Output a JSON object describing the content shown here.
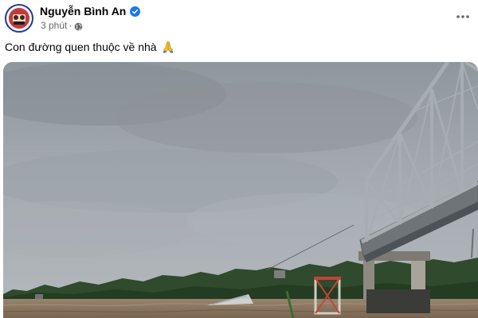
{
  "post": {
    "author": {
      "name": "Nguyễn Bình An",
      "verified": true,
      "avatar_icon": "profile-avatar"
    },
    "time": "3 phút",
    "privacy_icon": "globe-icon",
    "more_icon": "more-options-icon",
    "caption": {
      "text": "Con đường quen thuộc về nhà",
      "emoji_icon": "folded-hands-emoji"
    },
    "photo": {
      "subject": "photo-of-flooded-river-under-steel-bridge"
    }
  },
  "colors": {
    "verified": "#1877f2",
    "secondary_text": "#65676b",
    "avatar_ring": "#1f3a93",
    "sky": "#9ea4a9",
    "river": "#8a7660",
    "bridge": "#8d9295"
  }
}
